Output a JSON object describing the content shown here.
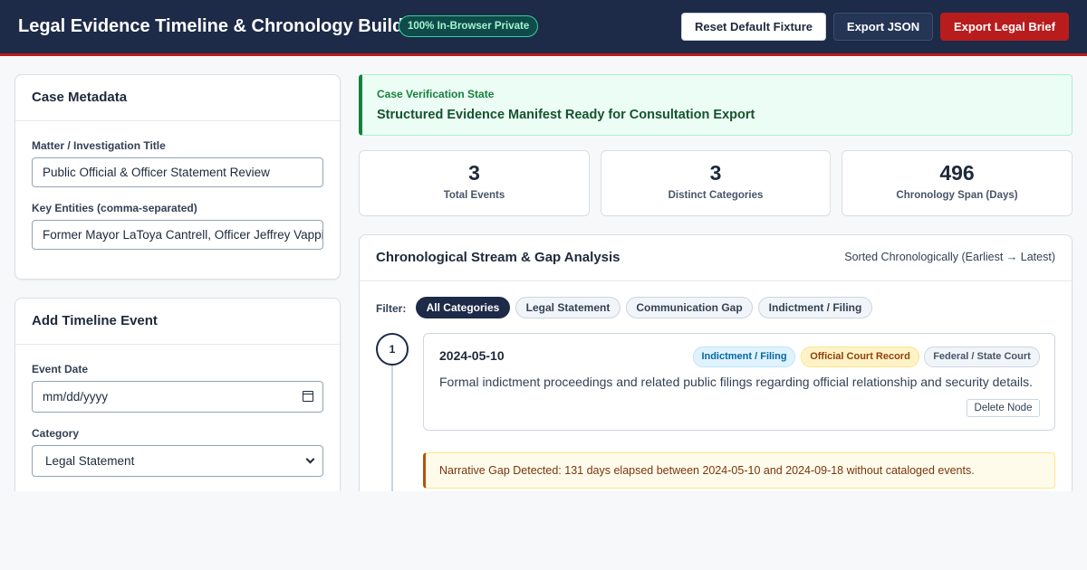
{
  "header": {
    "title": "Legal Evidence Timeline & Chronology Builder",
    "badge": "100% In-Browser Private",
    "reset_label": "Reset Default Fixture",
    "export_json_label": "Export JSON",
    "export_brief_label": "Export Legal Brief",
    "colors": {
      "bar": "#1d2a48",
      "accent_red": "#b91c1c"
    }
  },
  "case_metadata": {
    "heading": "Case Metadata",
    "title_label": "Matter / Investigation Title",
    "title_value": "Public Official & Officer Statement Review",
    "entities_label": "Key Entities (comma-separated)",
    "entities_value": "Former Mayor LaToya Cantrell, Officer Jeffrey Vappie"
  },
  "add_event": {
    "heading": "Add Timeline Event",
    "date_label": "Event Date",
    "date_placeholder": "mm/dd/yyyy",
    "date_icon": "calendar-icon",
    "category_label": "Category",
    "category_value": "Legal Statement",
    "category_icon": "chevron-down-icon"
  },
  "verification": {
    "label": "Case Verification State",
    "message": "Structured Evidence Manifest Ready for Consultation Export",
    "color": "#15803d"
  },
  "stats": [
    {
      "value": "3",
      "label": "Total Events"
    },
    {
      "value": "3",
      "label": "Distinct Categories"
    },
    {
      "value": "496",
      "label": "Chronology Span (Days)"
    }
  ],
  "stream": {
    "heading": "Chronological Stream & Gap Analysis",
    "sort_label": "Sorted Chronologically (Earliest → Latest)",
    "filter_label": "Filter:",
    "filters": [
      "All Categories",
      "Legal Statement",
      "Communication Gap",
      "Indictment / Filing"
    ],
    "active_filter": "All Categories",
    "events": [
      {
        "index": "1",
        "date": "2024-05-10",
        "tags": [
          "Indictment / Filing",
          "Official Court Record",
          "Federal / State Court"
        ],
        "description": "Formal indictment proceedings and related public filings regarding official relationship and security details.",
        "delete_label": "Delete Node"
      }
    ],
    "gap_notice": "Narrative Gap Detected: 131 days elapsed between 2024-05-10 and 2024-09-18 without cataloged events."
  }
}
